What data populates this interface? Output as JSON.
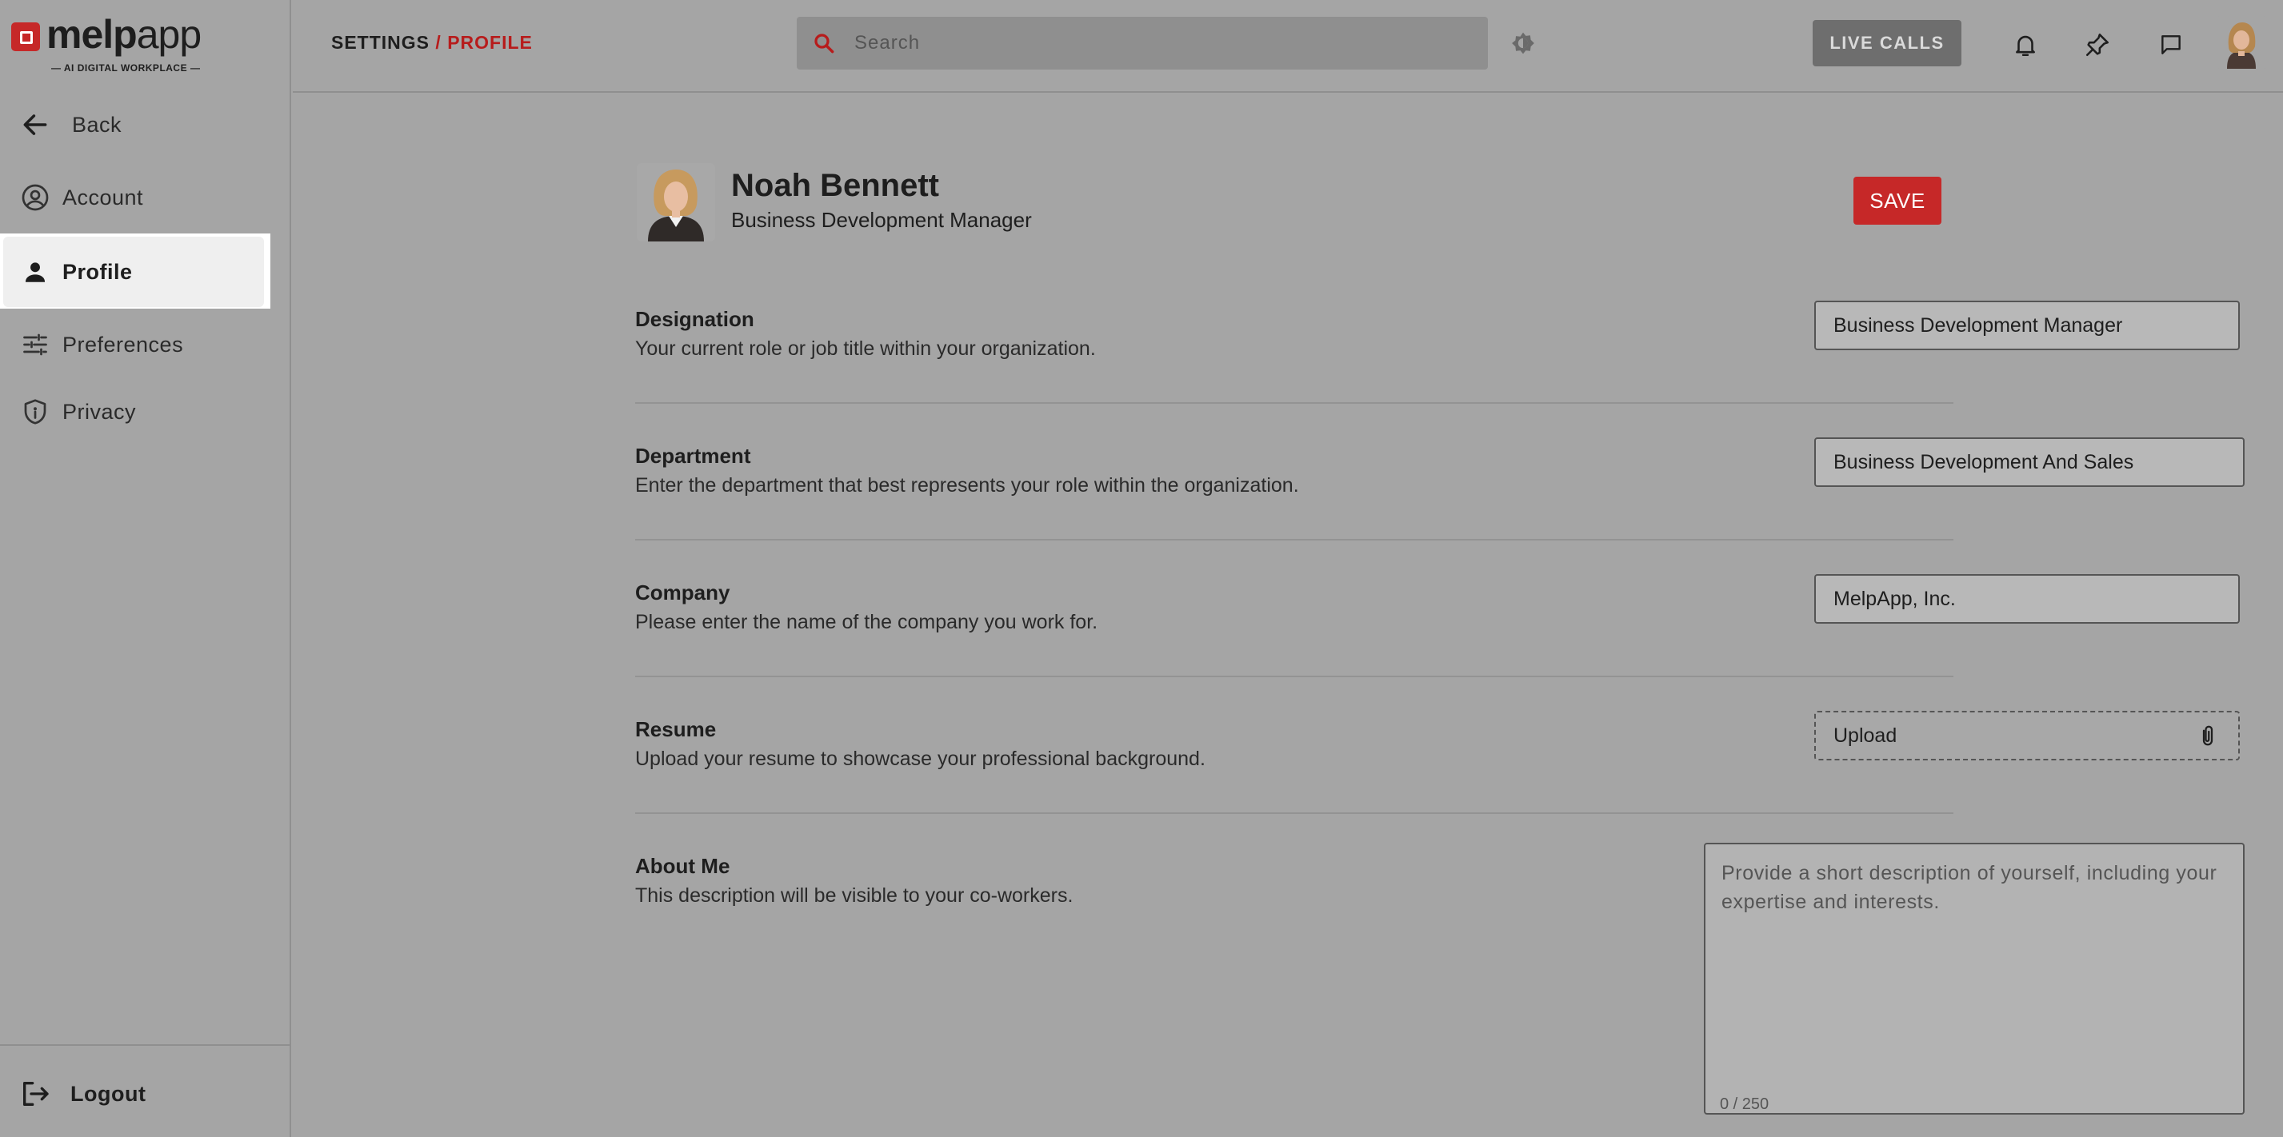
{
  "brand": {
    "name_bold": "melp",
    "name_light": "app",
    "tagline": "— AI DIGITAL WORKPLACE —",
    "accent_color": "#c62828"
  },
  "sidebar": {
    "back_label": "Back",
    "items": [
      {
        "label": "Account",
        "icon": "account-circle-icon"
      },
      {
        "label": "Profile",
        "icon": "person-icon",
        "active": true
      },
      {
        "label": "Preferences",
        "icon": "sliders-icon"
      },
      {
        "label": "Privacy",
        "icon": "shield-icon"
      }
    ],
    "logout_label": "Logout"
  },
  "header": {
    "breadcrumb_root": "SETTINGS",
    "breadcrumb_sep": "/",
    "breadcrumb_current": "PROFILE",
    "search_placeholder": "Search",
    "live_calls_label": "LIVE CALLS",
    "icons": [
      "theme-icon",
      "bell-icon",
      "pin-icon",
      "chat-icon",
      "user-avatar"
    ]
  },
  "profile": {
    "name": "Noah Bennett",
    "title": "Business Development Manager",
    "save_label": "SAVE"
  },
  "fields": {
    "designation": {
      "label": "Designation",
      "description": "Your current role or job title within your organization.",
      "value": "Business Development Manager"
    },
    "department": {
      "label": "Department",
      "description": "Enter the department that best represents your role within the organization.",
      "value": "Business Development And Sales"
    },
    "company": {
      "label": "Company",
      "description": "Please enter the name of the company you work for.",
      "value": "MelpApp, Inc."
    },
    "resume": {
      "label": "Resume",
      "description": "Upload your resume to showcase your professional background.",
      "upload_label": "Upload"
    },
    "about": {
      "label": "About Me",
      "description": "This description will be visible to your co-workers.",
      "placeholder": "Provide a short description of yourself, including your expertise and interests.",
      "char_count": "0 / 250"
    }
  }
}
